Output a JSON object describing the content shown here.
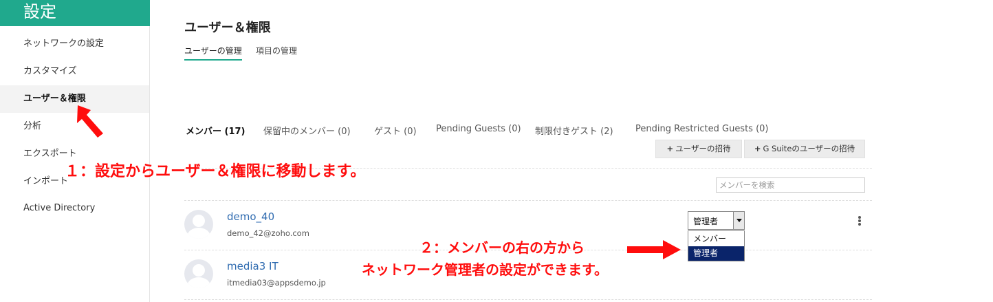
{
  "sidebar": {
    "title": "設定",
    "items": [
      {
        "label": "ネットワークの設定"
      },
      {
        "label": "カスタマイズ"
      },
      {
        "label": "ユーザー＆権限"
      },
      {
        "label": "分析"
      },
      {
        "label": "エクスポート"
      },
      {
        "label": "インポート"
      },
      {
        "label": "Active Directory"
      }
    ],
    "active_item": "ユーザー＆権限"
  },
  "main": {
    "title": "ユーザー＆権限",
    "subtabs": [
      {
        "label": "ユーザーの管理"
      },
      {
        "label": "項目の管理"
      }
    ],
    "member_tabs": [
      {
        "label": "メンバー (17)"
      },
      {
        "label": "保留中のメンバー (0)"
      },
      {
        "label": "ゲスト (0)"
      },
      {
        "label": "Pending Guests (0)"
      },
      {
        "label": "制限付きゲスト (2)"
      },
      {
        "label": "Pending Restricted Guests (0)"
      }
    ],
    "buttons": {
      "invite_user": "ユーザーの招待",
      "invite_gsuite": "G Suiteのユーザーの招待",
      "plus_glyph": "+"
    },
    "search": {
      "placeholder": "メンバーを検索",
      "value": ""
    },
    "members": [
      {
        "name": "demo_40",
        "email": "demo_42@zoho.com"
      },
      {
        "name": "media3 IT",
        "email": "itmedia03@appsdemo.jp"
      }
    ],
    "role_select": {
      "value": "管理者",
      "options": [
        "メンバー",
        "管理者"
      ],
      "highlighted": "管理者"
    }
  },
  "annotations": {
    "step1": "１：設定からユーザー＆権限に移動します。",
    "step2_line1": "２：メンバーの右の方から",
    "step2_line2": "ネットワーク管理者の設定ができます。"
  },
  "colors": {
    "accent": "#20a98d",
    "link": "#2f6bb0",
    "annotation": "#ff0d0d",
    "dropdown_highlight": "#0a246a"
  },
  "icons": [
    "avatar-placeholder-icon",
    "more-vertical-icon",
    "dropdown-arrow-icon",
    "annotation-arrow-icon"
  ]
}
